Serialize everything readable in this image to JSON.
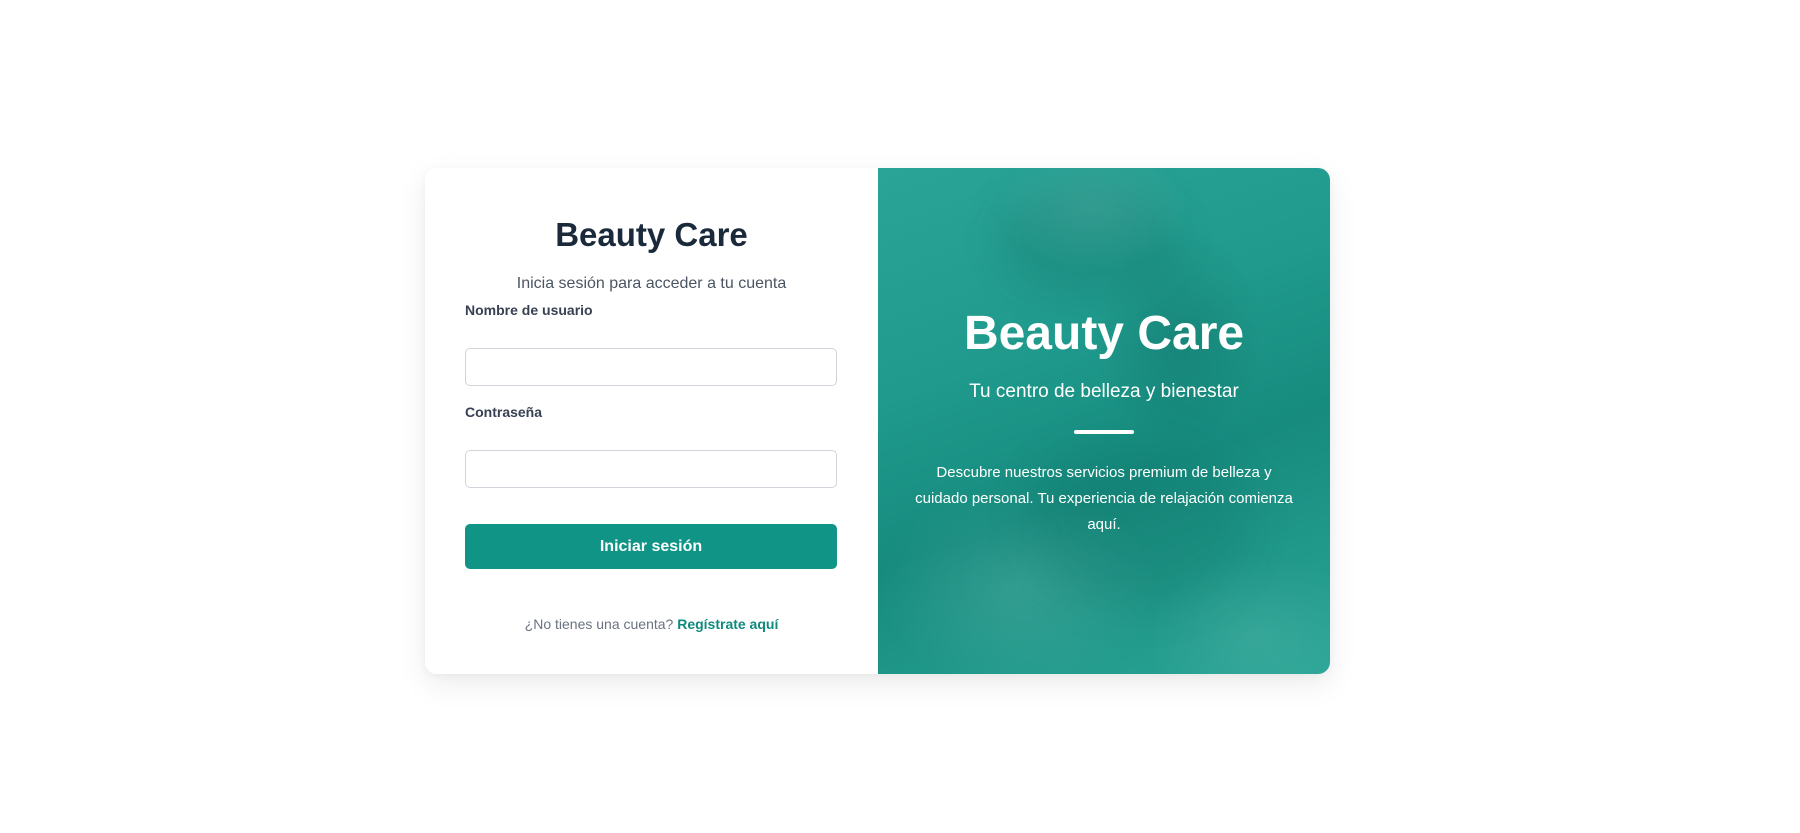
{
  "login": {
    "title": "Beauty Care",
    "subtitle": "Inicia sesión para acceder a tu cuenta",
    "username_label": "Nombre de usuario",
    "username_value": "",
    "password_label": "Contraseña",
    "password_value": "",
    "submit_label": "Iniciar sesión",
    "register_prompt": "¿No tienes una cuenta?",
    "register_link": "Regístrate aquí"
  },
  "hero": {
    "title": "Beauty Care",
    "tagline": "Tu centro de belleza y bienestar",
    "description": "Descubre nuestros servicios premium de belleza y cuidado personal. Tu experiencia de relajación comienza aquí."
  },
  "colors": {
    "accent": "#0f9486",
    "hero_overlay": "#1f9a8c",
    "title_text": "#1b2a3b"
  }
}
